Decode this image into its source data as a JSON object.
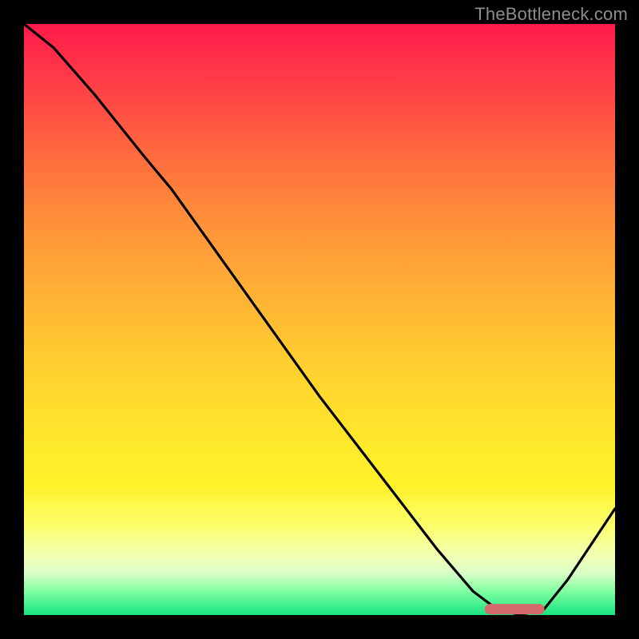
{
  "attribution": "TheBottleneck.com",
  "colors": {
    "frame": "#000000",
    "curve": "#000000",
    "marker": "#d46a6a",
    "gradient_top": "#ff1a4a",
    "gradient_mid": "#ffe72b",
    "gradient_bottom": "#18e480"
  },
  "chart_data": {
    "type": "line",
    "title": "",
    "xlabel": "",
    "ylabel": "",
    "xlim": [
      0,
      100
    ],
    "ylim": [
      0,
      100
    ],
    "grid": false,
    "legend": false,
    "x": [
      0,
      5,
      12,
      20,
      25,
      30,
      40,
      50,
      60,
      70,
      76,
      80,
      84,
      88,
      92,
      100
    ],
    "values": [
      100,
      96,
      88,
      78,
      72,
      65,
      51,
      37,
      24,
      11,
      4,
      1,
      0,
      1,
      6,
      18
    ],
    "marker_range_x": [
      78,
      88
    ],
    "marker_y": 1
  }
}
